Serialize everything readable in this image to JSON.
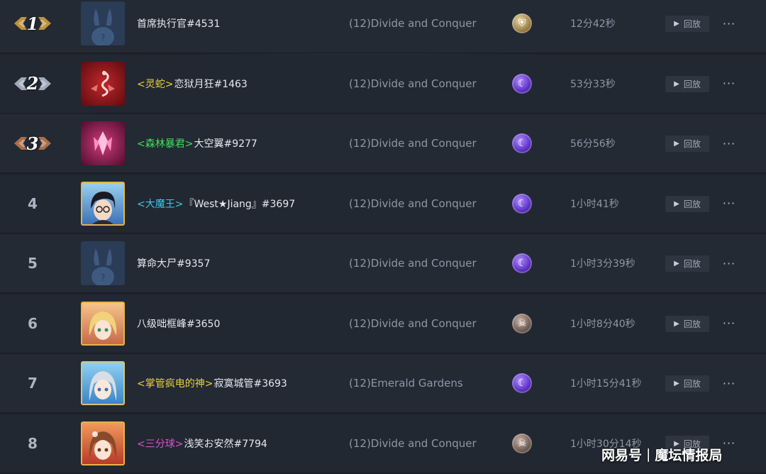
{
  "rows": [
    {
      "rank": "1",
      "medal": "gold",
      "avatar": "default-rabbit-avatar",
      "tag": "",
      "name": "首席执行官#4531",
      "map": "(12)Divide and Conquer",
      "race": "human-icon",
      "time": "12分42秒",
      "replay": "回放"
    },
    {
      "rank": "2",
      "medal": "silver",
      "avatar": "red-serpent-avatar",
      "tag": "<灵蛇>",
      "tag_color": "#e7d23a",
      "name": "恋狱月狂#1463",
      "map": "(12)Divide and Conquer",
      "race": "night-elf-icon",
      "time": "53分33秒",
      "replay": "回放"
    },
    {
      "rank": "3",
      "medal": "bronze",
      "avatar": "pink-crystal-avatar",
      "tag": "<森林暴君>",
      "tag_color": "#3ee05a",
      "name": "大空翼#9277",
      "map": "(12)Divide and Conquer",
      "race": "night-elf-icon",
      "time": "56分56秒",
      "replay": "回放"
    },
    {
      "rank": "4",
      "medal": "",
      "avatar": "anime-boy-glasses-avatar",
      "tag": "<大魔王>",
      "tag_color": "#3ec9e8",
      "name": "『West★Jiang』#3697",
      "map": "(12)Divide and Conquer",
      "race": "night-elf-icon",
      "time": "1小时41秒",
      "replay": "回放"
    },
    {
      "rank": "5",
      "medal": "",
      "avatar": "default-rabbit-avatar",
      "tag": "",
      "name": "算命大尸#9357",
      "map": "(12)Divide and Conquer",
      "race": "night-elf-icon",
      "time": "1小时3分39秒",
      "replay": "回放"
    },
    {
      "rank": "6",
      "medal": "",
      "avatar": "anime-girl-blonde-avatar",
      "tag": "",
      "name": "八级咄框峰#3650",
      "map": "(12)Divide and Conquer",
      "race": "undead-icon",
      "time": "1小时8分40秒",
      "replay": "回放"
    },
    {
      "rank": "7",
      "medal": "",
      "avatar": "anime-girl-silver-avatar",
      "tag": "<掌管疯电的神>",
      "tag_color": "#e7d23a",
      "name": "寂寞城管#3693",
      "map": "(12)Emerald Gardens",
      "race": "night-elf-icon",
      "time": "1小时15分41秒",
      "replay": "回放"
    },
    {
      "rank": "8",
      "medal": "",
      "avatar": "anime-girl-brown-avatar",
      "tag": "<三分球>",
      "tag_color": "#e04fcf",
      "name": "浅笑お安然#7794",
      "map": "(12)Divide and Conquer",
      "race": "undead-icon",
      "time": "1小时30分14秒",
      "replay": "回放"
    }
  ],
  "more_label": "···",
  "watermark": {
    "left": "网易号",
    "sep": "|",
    "right": "魔坛情报局"
  },
  "colors": {
    "gold": "#d9a441",
    "silver": "#b7c2cf",
    "bronze": "#c47a4a",
    "night_elf": "#7a4ad8",
    "human": "#b89a5a",
    "undead": "#8a7468"
  }
}
